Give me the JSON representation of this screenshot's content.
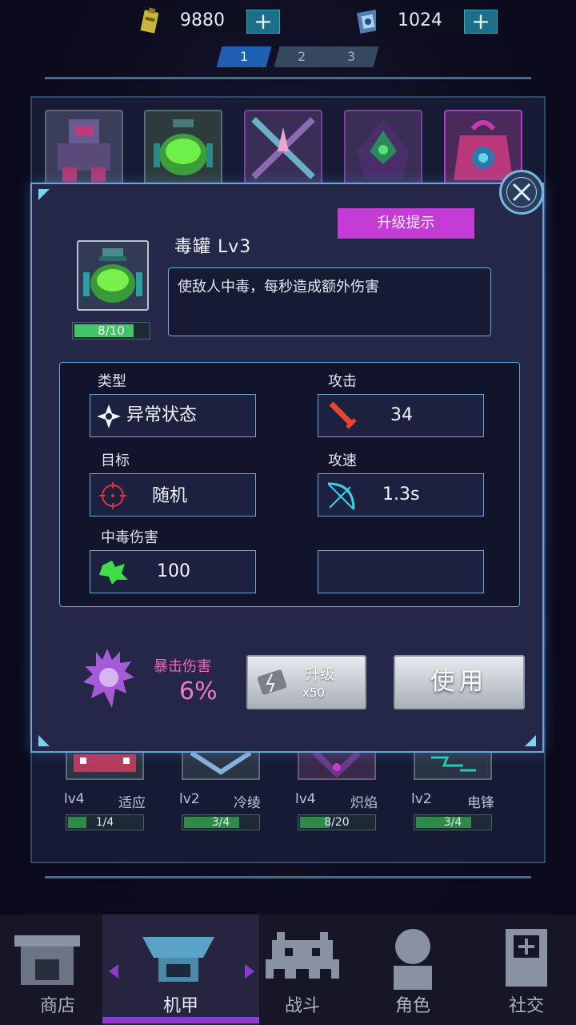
{
  "currency": {
    "gold": {
      "icon": "battery-icon",
      "value": "9880",
      "plus": "+"
    },
    "gems": {
      "icon": "chip-icon",
      "value": "1024",
      "plus": "+"
    }
  },
  "pages": [
    {
      "label": "1",
      "active": true
    },
    {
      "label": "2",
      "active": false
    },
    {
      "label": "3",
      "active": false
    }
  ],
  "background_items": [
    {
      "level": "lv4",
      "name": "适应",
      "progress": "1/4",
      "fill": 0.25
    },
    {
      "level": "lv2",
      "name": "冷绫",
      "progress": "3/4",
      "fill": 0.75
    },
    {
      "level": "lv4",
      "name": "炽焰",
      "progress": "8/20",
      "fill": 0.4
    },
    {
      "level": "lv2",
      "name": "电锋",
      "progress": "3/4",
      "fill": 0.75
    }
  ],
  "modal": {
    "hint_button": "升级提示",
    "item_name": "毒罐 Lv3",
    "shards": "8/10",
    "shard_fill": 0.8,
    "description": "使敌人中毒，每秒造成额外伤害",
    "stats": {
      "type_label": "类型",
      "type_value": "异常状态",
      "attack_label": "攻击",
      "attack_value": "34",
      "target_label": "目标",
      "target_value": "随机",
      "speed_label": "攻速",
      "speed_value": "1.3s",
      "poison_label": "中毒伤害",
      "poison_value": "100"
    },
    "crit_label": "暴击伤害",
    "crit_value": "6%",
    "upgrade_label": "升级",
    "upgrade_cost": "x50",
    "use_label": "使用"
  },
  "nav": [
    {
      "label": "商店",
      "icon": "shop-icon",
      "active": false
    },
    {
      "label": "机甲",
      "icon": "mech-icon",
      "active": true
    },
    {
      "label": "战斗",
      "icon": "invader-icon",
      "active": false
    },
    {
      "label": "角色",
      "icon": "character-icon",
      "active": false
    },
    {
      "label": "社交",
      "icon": "social-icon",
      "active": false
    }
  ],
  "colors": {
    "accent_magenta": "#c43bd6",
    "frame_blue": "#6ea3d6",
    "poison_green": "#45c467"
  }
}
